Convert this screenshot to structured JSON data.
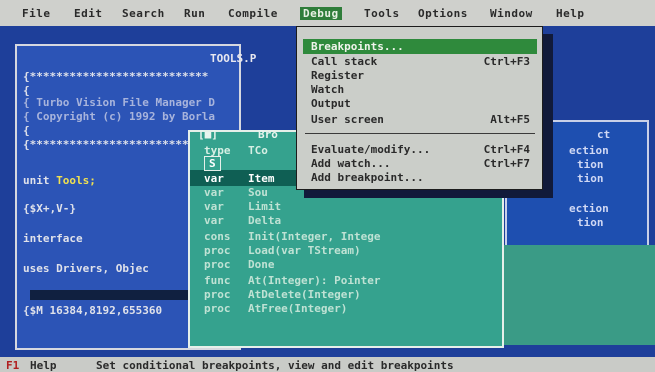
{
  "menubar": {
    "items": [
      "File",
      "Edit",
      "Search",
      "Run",
      "Compile",
      "Debug",
      "Tools",
      "Options",
      "Window",
      "Help"
    ]
  },
  "editor": {
    "title": "TOOLS.P",
    "lines": [
      "{***************************",
      "{",
      "{   Turbo Vision File Manager D",
      "{   Copyright (c) 1992 by Borla",
      "{",
      "{***************************",
      "unit Tools;",
      "{$X+,V-}",
      "interface",
      "uses Drivers, Objec",
      "{$M 16384,8192,655360"
    ],
    "unit_keyword": "unit",
    "unit_name": "Tools;"
  },
  "browse": {
    "title": "Bro",
    "header": [
      "type",
      "TCo"
    ],
    "box_label": "S",
    "rows": [
      [
        "var",
        "Item"
      ],
      [
        "var",
        "Sou"
      ],
      [
        "var",
        "Limit"
      ],
      [
        "var",
        "Delta"
      ],
      [
        "cons",
        "Init(Integer, Intege"
      ],
      [
        "proc",
        "Load(var TStream)"
      ],
      [
        "proc",
        "Done"
      ],
      [
        "func",
        "At(Integer): Pointer"
      ],
      [
        "proc",
        "AtDelete(Integer)"
      ],
      [
        "proc",
        "AtFree(Integer)"
      ]
    ]
  },
  "back_windows": {
    "right_text": [
      "ct",
      "ection",
      "tion",
      "tion",
      "ection",
      "tion"
    ]
  },
  "debug_menu": {
    "items": [
      {
        "label": "Breakpoints...",
        "shortcut": ""
      },
      {
        "label": "Call stack",
        "shortcut": "Ctrl+F3"
      },
      {
        "label": "Register",
        "shortcut": ""
      },
      {
        "label": "Watch",
        "shortcut": ""
      },
      {
        "label": "Output",
        "shortcut": ""
      },
      {
        "label": "User screen",
        "shortcut": "Alt+F5"
      },
      {
        "label": "Evaluate/modify...",
        "shortcut": "Ctrl+F4"
      },
      {
        "label": "Add watch...",
        "shortcut": "Ctrl+F7"
      },
      {
        "label": "Add breakpoint...",
        "shortcut": ""
      }
    ]
  },
  "status": {
    "help_key": "F1",
    "help_label": "Help",
    "message": "Set conditional breakpoints, view and edit breakpoints"
  }
}
